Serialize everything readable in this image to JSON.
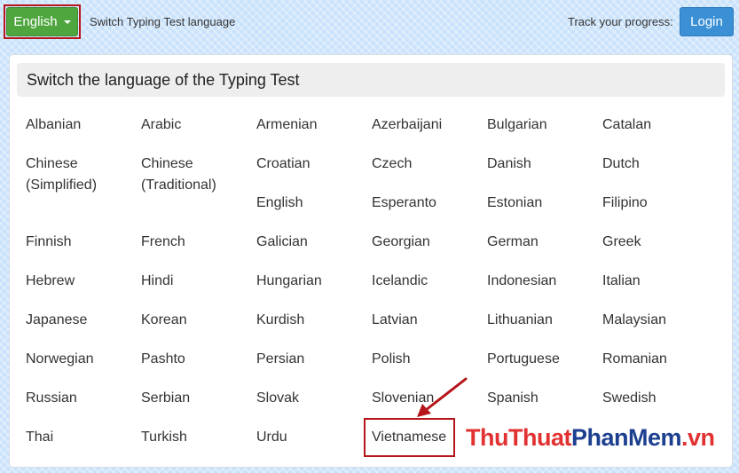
{
  "topbar": {
    "language_button": "English",
    "switch_text": "Switch Typing Test language",
    "track_text": "Track your progress:",
    "login_button": "Login"
  },
  "panel": {
    "title": "Switch the language of the Typing Test"
  },
  "languages": [
    "Albanian",
    "Arabic",
    "Armenian",
    "Azerbaijani",
    "Bulgarian",
    "Catalan",
    "Chinese\n(Simplified)",
    "Chinese\n(Traditional)",
    "Croatian",
    "Czech",
    "Danish",
    "Dutch",
    "English",
    "Esperanto",
    "Estonian",
    "Filipino",
    "Finnish",
    "French",
    "Galician",
    "Georgian",
    "German",
    "Greek",
    "Hebrew",
    "Hindi",
    "Hungarian",
    "Icelandic",
    "Indonesian",
    "Italian",
    "Japanese",
    "Korean",
    "Kurdish",
    "Latvian",
    "Lithuanian",
    "Malaysian",
    "Norwegian",
    "Pashto",
    "Persian",
    "Polish",
    "Portuguese",
    "Romanian",
    "Russian",
    "Serbian",
    "Slovak",
    "Slovenian",
    "Spanish",
    "Swedish",
    "Thai",
    "Turkish",
    "Urdu",
    "Vietnamese"
  ],
  "highlighted_language": "Vietnamese",
  "watermark": {
    "part1": "ThuThuat",
    "part2": "PhanMem",
    "part3": ".vn"
  },
  "colors": {
    "accent_green": "#4fa63f",
    "login_blue": "#3a8fd5",
    "highlight_red": "#b5151b"
  },
  "icons": {
    "dropdown": "caret-down-icon",
    "annotation": "arrow-icon"
  }
}
